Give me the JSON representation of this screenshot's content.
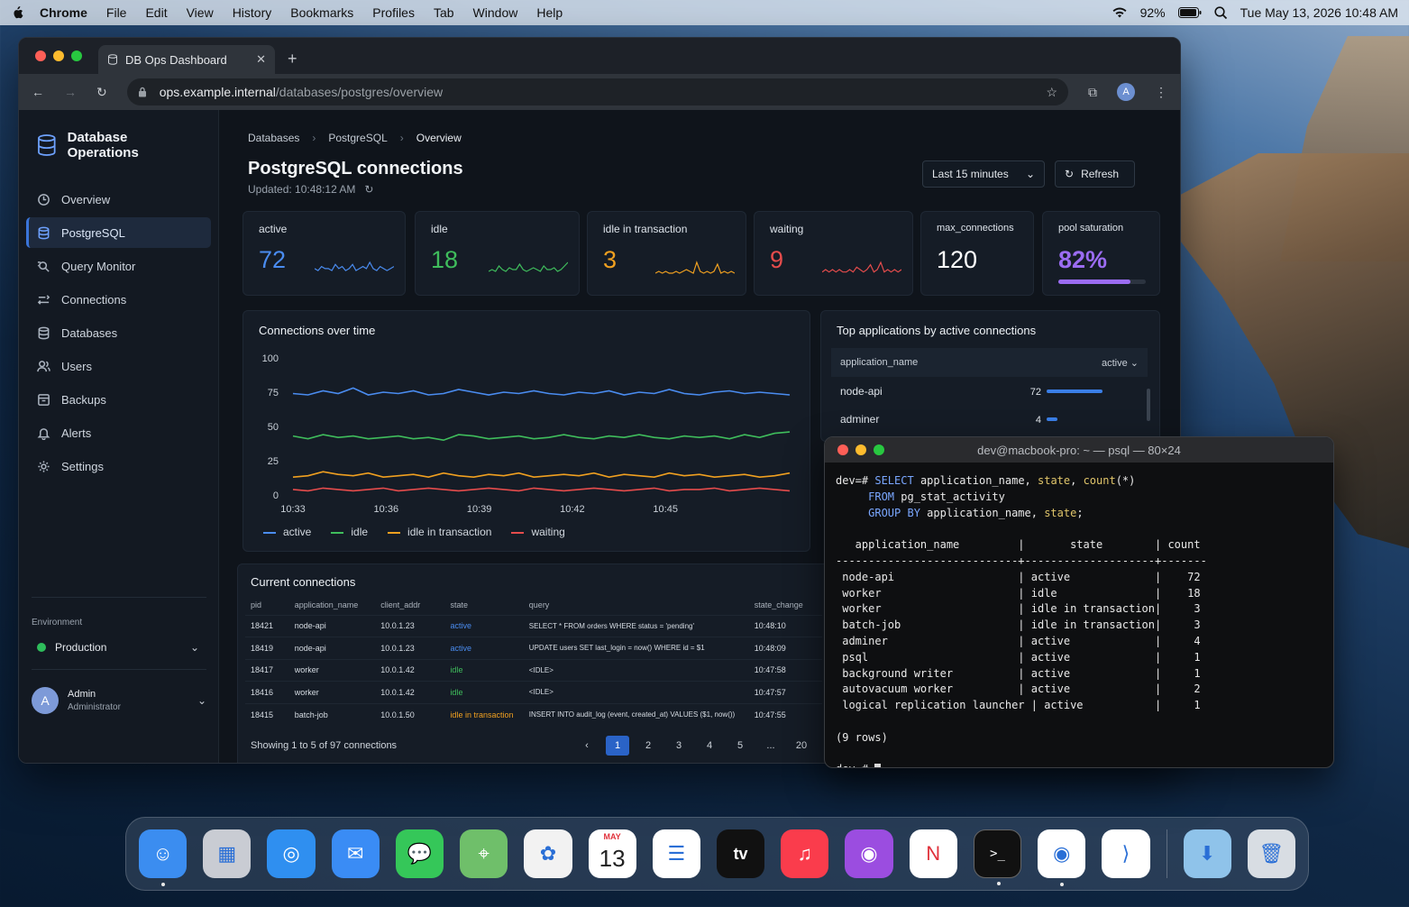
{
  "menubar": {
    "app": "Chrome",
    "items": [
      "File",
      "Edit",
      "View",
      "History",
      "Bookmarks",
      "Profiles",
      "Tab",
      "Window",
      "Help"
    ],
    "battery": "92%",
    "clock": "Tue May 13, 2026  10:48 AM"
  },
  "browser": {
    "tab_title": "DB Ops Dashboard",
    "url_host": "ops.example.internal",
    "url_path": "/databases/postgres/overview",
    "profile_initial": "A"
  },
  "sidebar": {
    "brand": "Database Operations",
    "items": [
      {
        "label": "Overview",
        "icon": "overview-icon"
      },
      {
        "label": "PostgreSQL",
        "icon": "database-icon"
      },
      {
        "label": "Query Monitor",
        "icon": "query-monitor-icon"
      },
      {
        "label": "Connections",
        "icon": "connections-icon"
      },
      {
        "label": "Databases",
        "icon": "databases-icon"
      },
      {
        "label": "Users",
        "icon": "users-icon"
      },
      {
        "label": "Backups",
        "icon": "backups-icon"
      },
      {
        "label": "Alerts",
        "icon": "bell-icon"
      },
      {
        "label": "Settings",
        "icon": "gear-icon"
      }
    ],
    "env_label": "Environment",
    "env_value": "Production",
    "user_initial": "A",
    "user_name": "Admin",
    "user_role": "Administrator"
  },
  "breadcrumb": [
    "Databases",
    "PostgreSQL",
    "Overview"
  ],
  "page": {
    "title": "PostgreSQL connections",
    "updated": "Updated: 10:48:12 AM",
    "range": "Last 15 minutes",
    "refresh": "Refresh"
  },
  "kpis": [
    {
      "label": "active",
      "value": "72",
      "color": "#4a8cf0"
    },
    {
      "label": "idle",
      "value": "18",
      "color": "#3fbd5c"
    },
    {
      "label": "idle in transaction",
      "value": "3",
      "color": "#f0a020"
    },
    {
      "label": "waiting",
      "value": "9",
      "color": "#e54c4c"
    },
    {
      "label": "max_connections",
      "value": "120",
      "color": "#ffffff"
    },
    {
      "label": "pool saturation",
      "value": "82%",
      "color": "#9b6cf2",
      "fill": 0.82
    }
  ],
  "chart_title": "Connections over time",
  "chart_data": {
    "type": "line",
    "x": [
      "10:33",
      "10:36",
      "10:39",
      "10:42",
      "10:45"
    ],
    "ylim": [
      0,
      100
    ],
    "yticks": [
      0,
      25,
      50,
      75,
      100
    ],
    "series": [
      {
        "name": "active",
        "color": "#4a8cf0",
        "values": [
          74,
          73,
          76,
          74,
          78,
          73,
          75,
          74,
          76,
          73,
          74,
          77,
          75,
          73,
          75,
          74,
          76,
          74,
          73,
          75,
          74,
          76,
          73,
          75,
          74,
          77,
          74,
          73,
          75,
          76,
          74,
          75,
          74,
          73
        ]
      },
      {
        "name": "idle",
        "color": "#3fbd5c",
        "values": [
          43,
          41,
          44,
          42,
          43,
          41,
          42,
          43,
          41,
          42,
          40,
          44,
          43,
          41,
          42,
          43,
          41,
          42,
          44,
          42,
          41,
          43,
          42,
          44,
          42,
          41,
          43,
          42,
          43,
          41,
          44,
          42,
          45,
          46
        ]
      },
      {
        "name": "idle in transaction",
        "color": "#f0a020",
        "values": [
          13,
          14,
          17,
          15,
          14,
          16,
          13,
          14,
          15,
          13,
          16,
          14,
          13,
          15,
          14,
          16,
          13,
          14,
          15,
          14,
          16,
          13,
          15,
          14,
          13,
          16,
          14,
          15,
          13,
          14,
          15,
          13,
          14,
          16
        ]
      },
      {
        "name": "waiting",
        "color": "#e54c4c",
        "values": [
          4,
          3,
          5,
          4,
          3,
          4,
          5,
          3,
          4,
          5,
          4,
          3,
          4,
          5,
          4,
          3,
          5,
          4,
          3,
          4,
          5,
          4,
          3,
          4,
          5,
          3,
          4,
          4,
          5,
          3,
          4,
          5,
          4,
          3
        ]
      }
    ]
  },
  "apps": {
    "title": "Top applications by active connections",
    "col1": "application_name",
    "col2": "active",
    "rows": [
      {
        "name": "node-api",
        "value": "72",
        "frac": 0.86
      },
      {
        "name": "adminer",
        "value": "4",
        "frac": 0.16
      }
    ]
  },
  "conns": {
    "title": "Current connections",
    "headers": [
      "pid",
      "application_name",
      "client_addr",
      "state",
      "query",
      "state_change"
    ],
    "rows": [
      [
        "18421",
        "node-api",
        "10.0.1.23",
        "active",
        "SELECT * FROM orders WHERE status = 'pending'",
        "10:48:10"
      ],
      [
        "18419",
        "node-api",
        "10.0.1.23",
        "active",
        "UPDATE users SET last_login = now() WHERE id = $1",
        "10:48:09"
      ],
      [
        "18417",
        "worker",
        "10.0.1.42",
        "idle",
        "<IDLE>",
        "10:47:58"
      ],
      [
        "18416",
        "worker",
        "10.0.1.42",
        "idle",
        "<IDLE>",
        "10:47:57"
      ],
      [
        "18415",
        "batch-job",
        "10.0.1.50",
        "idle in transaction",
        "INSERT INTO audit_log (event, created_at) VALUES ($1, now())",
        "10:47:55"
      ]
    ],
    "showing": "Showing 1 to 5 of 97 connections",
    "pages": [
      "1",
      "2",
      "3",
      "4",
      "5",
      "...",
      "20"
    ]
  },
  "terminal": {
    "title": "dev@macbook-pro: ~ — psql — 80×24",
    "prompt": "dev=#",
    "query": [
      "SELECT application_name, state, count(*)",
      "     FROM pg_stat_activity",
      "     GROUP BY application_name, state;"
    ],
    "header": "   application_name         |       state        | count",
    "divider": "----------------------------+--------------------+-------",
    "rows": [
      " node-api                   | active             |    72",
      " worker                     | idle               |    18",
      " worker                     | idle in transaction|     3",
      " batch-job                  | idle in transaction|     3",
      " adminer                    | active             |     4",
      " psql                       | active             |     1",
      " background writer          | active             |     1",
      " autovacuum worker          | active             |     2",
      " logical replication launcher | active           |     1"
    ],
    "footer": "(9 rows)"
  },
  "dock": [
    {
      "name": "finder-icon",
      "color": "#3b8df0",
      "glyph": "☺"
    },
    {
      "name": "launchpad-icon",
      "color": "#c9ccd3",
      "glyph": "▦"
    },
    {
      "name": "safari-icon",
      "color": "#2f8ff0",
      "glyph": "◎"
    },
    {
      "name": "mail-icon",
      "color": "#3a8cf5",
      "glyph": "✉"
    },
    {
      "name": "messages-icon",
      "color": "#35c759",
      "glyph": "💬"
    },
    {
      "name": "maps-icon",
      "color": "#6fbf6a",
      "glyph": "⌖"
    },
    {
      "name": "photos-icon",
      "color": "#f2f2f2",
      "glyph": "✿"
    },
    {
      "name": "calendar-icon",
      "color": "#ffffff",
      "glyph": "13"
    },
    {
      "name": "reminders-icon",
      "color": "#ffffff",
      "glyph": "☰"
    },
    {
      "name": "tv-icon",
      "color": "#111111",
      "glyph": "tv"
    },
    {
      "name": "music-icon",
      "color": "#fa3c4c",
      "glyph": "♫"
    },
    {
      "name": "podcasts-icon",
      "color": "#9b4de0",
      "glyph": "◉"
    },
    {
      "name": "news-icon",
      "color": "#ffffff",
      "glyph": "N"
    },
    {
      "name": "terminal-icon",
      "color": "#111111",
      "glyph": ">_"
    },
    {
      "name": "chrome-icon",
      "color": "#ffffff",
      "glyph": "◉"
    },
    {
      "name": "vscode-icon",
      "color": "#ffffff",
      "glyph": "⟩"
    },
    {
      "name": "downloads-icon",
      "color": "#8fc3ea",
      "glyph": "⬇"
    },
    {
      "name": "trash-icon",
      "color": "#d8dde3",
      "glyph": "🗑"
    }
  ],
  "calendar_month": "MAY"
}
